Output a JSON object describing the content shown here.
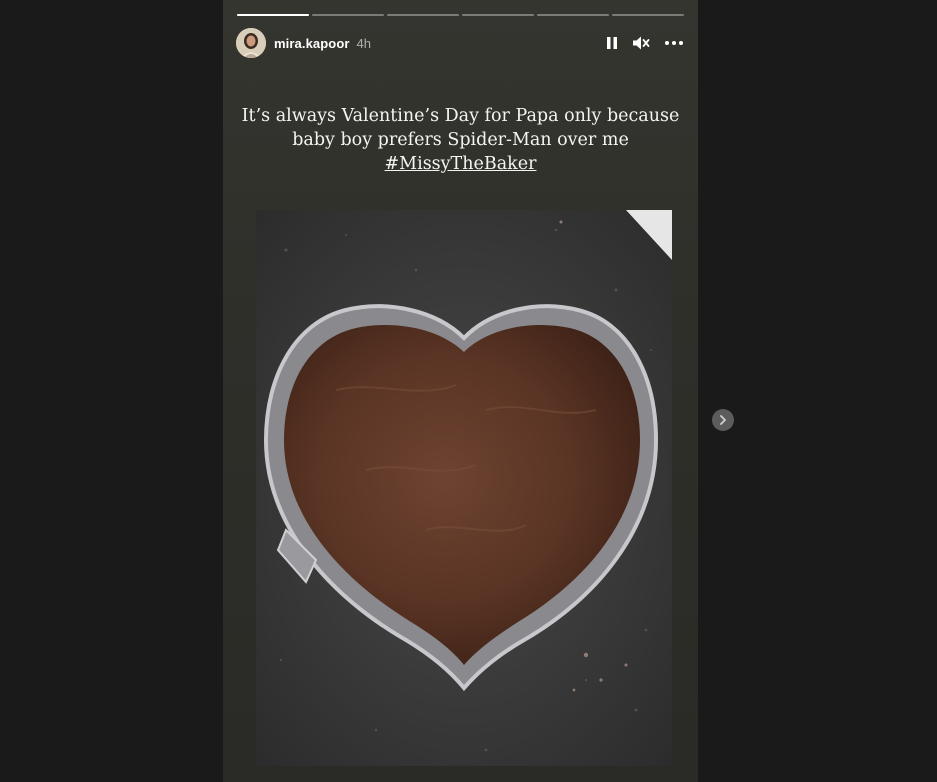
{
  "story": {
    "segments": [
      1,
      0,
      0,
      0,
      0,
      0
    ],
    "progress": {
      "completed": 0,
      "current_fraction": 1.0,
      "total": 6
    },
    "user": {
      "username": "mira.kapoor",
      "time_ago": "4h"
    },
    "caption": {
      "line1": "It’s always Valentine’s Day for Papa only because",
      "line2": "baby boy prefers Spider-Man over me",
      "hashtag": "#MissyTheBaker"
    },
    "controls": {
      "pause_icon": "pause-icon",
      "mute_icon": "muted-speaker-icon",
      "more_icon": "more-horizontal-icon"
    }
  },
  "navigation": {
    "next_icon": "chevron-right-icon"
  },
  "colors": {
    "page_bg": "#1a1a1a",
    "story_bg": "#2f2f2a",
    "text": "#ffffff"
  }
}
